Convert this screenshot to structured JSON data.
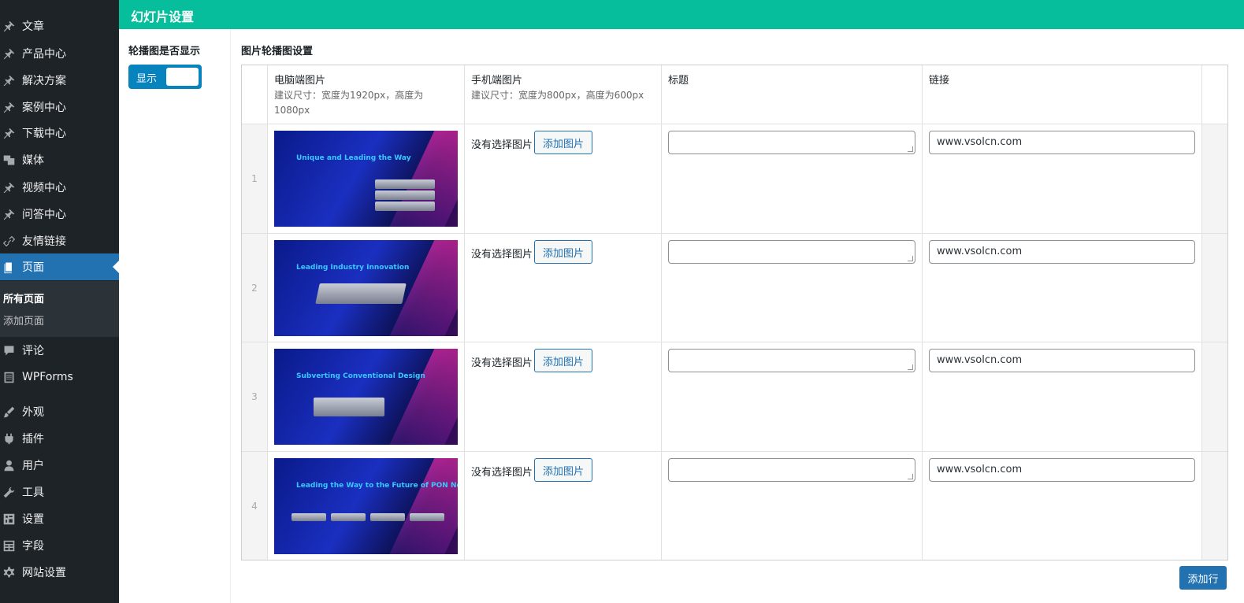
{
  "sidebar": {
    "items": [
      {
        "label": "文章",
        "icon": "pin-icon"
      },
      {
        "label": "产品中心",
        "icon": "pin-icon"
      },
      {
        "label": "解决方案",
        "icon": "pin-icon"
      },
      {
        "label": "案例中心",
        "icon": "pin-icon"
      },
      {
        "label": "下载中心",
        "icon": "pin-icon"
      },
      {
        "label": "媒体",
        "icon": "media-icon"
      },
      {
        "label": "视频中心",
        "icon": "pin-icon"
      },
      {
        "label": "问答中心",
        "icon": "pin-icon"
      },
      {
        "label": "友情链接",
        "icon": "link-icon"
      },
      {
        "label": "页面",
        "icon": "page-icon"
      },
      {
        "label": "评论",
        "icon": "comment-icon"
      },
      {
        "label": "WPForms",
        "icon": "forms-icon"
      },
      {
        "label": "外观",
        "icon": "brush-icon"
      },
      {
        "label": "插件",
        "icon": "plugin-icon"
      },
      {
        "label": "用户",
        "icon": "user-icon"
      },
      {
        "label": "工具",
        "icon": "wrench-icon"
      },
      {
        "label": "设置",
        "icon": "settings-icon"
      },
      {
        "label": "字段",
        "icon": "fields-icon"
      },
      {
        "label": "网站设置",
        "icon": "gear-icon"
      }
    ],
    "submenu": [
      "所有页面",
      "添加页面"
    ]
  },
  "header": {
    "title": "幻灯片设置"
  },
  "slider_toggle": {
    "label": "轮播图是否显示",
    "state_text": "显示"
  },
  "repeater": {
    "label": "图片轮播图设置",
    "columns": {
      "desktop": {
        "title": "电脑端图片",
        "hint": "建议尺寸：宽度为1920px，高度为1080px"
      },
      "mobile": {
        "title": "手机端图片",
        "hint": "建议尺寸：宽度为800px，高度为600px"
      },
      "title": {
        "title": "标题"
      },
      "link": {
        "title": "链接"
      }
    },
    "rows": [
      {
        "index": "1",
        "banner_text": "Unique and Leading the Way",
        "mobile_status": "没有选择图片",
        "add_image_label": "添加图片",
        "title_value": "",
        "link_value": "www.vsolcn.com"
      },
      {
        "index": "2",
        "banner_text": "Leading Industry Innovation",
        "mobile_status": "没有选择图片",
        "add_image_label": "添加图片",
        "title_value": "",
        "link_value": "www.vsolcn.com"
      },
      {
        "index": "3",
        "banner_text": "Subverting Conventional Design",
        "mobile_status": "没有选择图片",
        "add_image_label": "添加图片",
        "title_value": "",
        "link_value": "www.vsolcn.com"
      },
      {
        "index": "4",
        "banner_text": "Leading the Way to the Future of PON Networks",
        "mobile_status": "没有选择图片",
        "add_image_label": "添加图片",
        "title_value": "",
        "link_value": "www.vsolcn.com"
      }
    ],
    "add_row_label": "添加行"
  },
  "colors": {
    "sidebar_bg": "#1d2327",
    "active": "#2271b1",
    "header_bg": "#06bd9c",
    "toggle": "#0783be"
  }
}
